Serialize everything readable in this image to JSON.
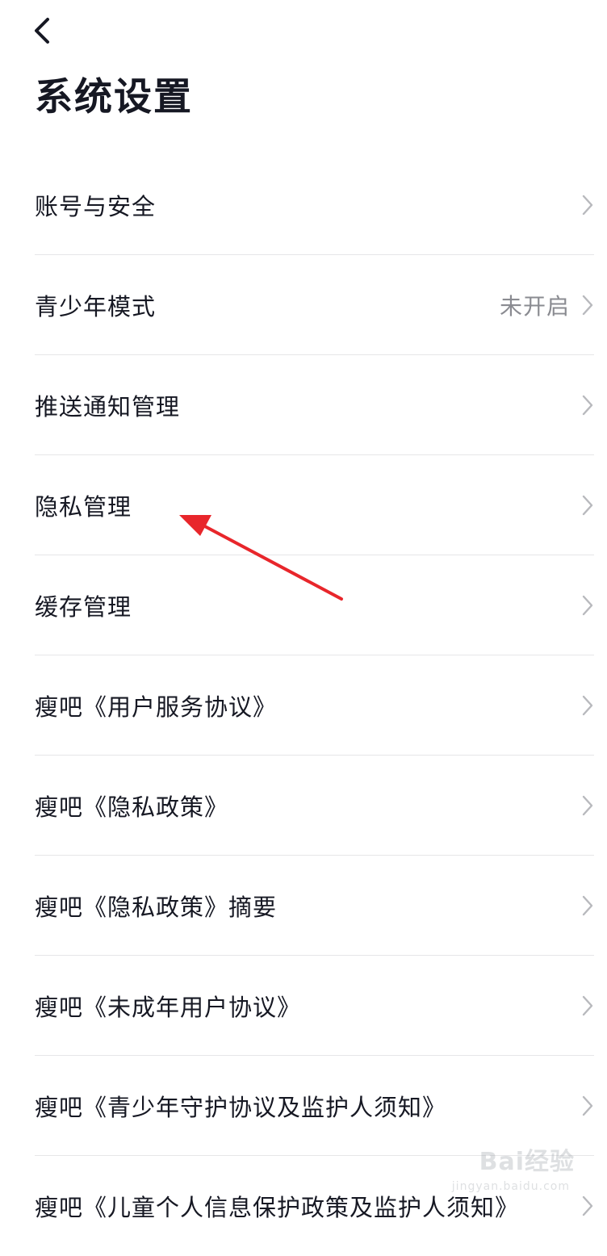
{
  "header": {
    "back_icon": "chevron-left-icon",
    "title": "系统设置"
  },
  "settings": {
    "items": [
      {
        "label": "账号与安全",
        "value": ""
      },
      {
        "label": "青少年模式",
        "value": "未开启"
      },
      {
        "label": "推送通知管理",
        "value": ""
      },
      {
        "label": "隐私管理",
        "value": ""
      },
      {
        "label": "缓存管理",
        "value": ""
      },
      {
        "label": "瘦吧《用户服务协议》",
        "value": ""
      },
      {
        "label": "瘦吧《隐私政策》",
        "value": ""
      },
      {
        "label": "瘦吧《隐私政策》摘要",
        "value": ""
      },
      {
        "label": "瘦吧《未成年用户协议》",
        "value": ""
      },
      {
        "label": "瘦吧《青少年守护协议及监护人须知》",
        "value": ""
      },
      {
        "label": "瘦吧《儿童个人信息保护政策及监护人须知》",
        "value": ""
      }
    ]
  },
  "annotation": {
    "arrow_color": "#e8262b",
    "points_to": "隐私管理"
  },
  "watermark": {
    "text": "Bai经验",
    "sub": "jingyan.baidu.com"
  },
  "colors": {
    "text_primary": "#161823",
    "text_secondary": "#8a8b91",
    "divider": "#e6e6e8",
    "chevron": "#b8b9bd"
  }
}
